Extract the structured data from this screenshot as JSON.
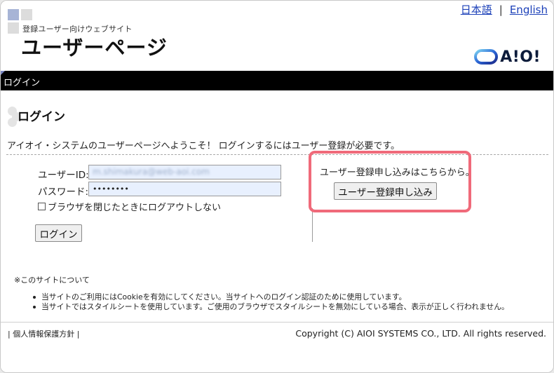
{
  "header": {
    "subtitle": "登録ユーザー向けウェブサイト",
    "title": "ユーザーページ",
    "lang_japanese": "日本語",
    "lang_separator": "|",
    "lang_english": "English",
    "brand_logo": "A!O!"
  },
  "nav": {
    "login_tab": "ログイン"
  },
  "main": {
    "heading": "ログイン",
    "intro": "アイオイ・システムのユーザーページへようこそ！ ログインするにはユーザー登録が必要です。",
    "login_form": {
      "user_id_label": "ユーザーID:",
      "user_id_value": "m.shimakura@web-aoi.com",
      "password_label": "パスワード:",
      "password_value": "••••••••",
      "keep_logged_in_label": "ブラウザを閉じたときにログアウトしない",
      "login_button": "ログイン"
    },
    "registration": {
      "prompt": "ユーザー登録申し込みはこちらから。",
      "button": "ユーザー登録申し込み"
    }
  },
  "notes": {
    "title": "※このサイトについて",
    "items": [
      "当サイトのご利用にはCookieを有効にしてください。当サイトへのログイン認証のために使用しています。",
      "当サイトではスタイルシートを使用しています。ご使用のブラウザでスタイルシートを無効にしている場合、表示が正しく行われません。"
    ]
  },
  "footer": {
    "privacy_link": "個人情報保護方針",
    "copyright": "Copyright (C) AIOI SYSTEMS CO., LTD. All rights reserved."
  },
  "colors": {
    "navbar": "#000000",
    "highlight": "#f06a7a",
    "link": "#1a3fb8",
    "input_bg": "#e8f0fe"
  },
  "icons": {
    "site_logo": "squares-logo-icon",
    "brand_mark": "aio-ring-logo-icon",
    "heading_mark": "dots-icon",
    "checkbox": "checkbox-icon"
  }
}
